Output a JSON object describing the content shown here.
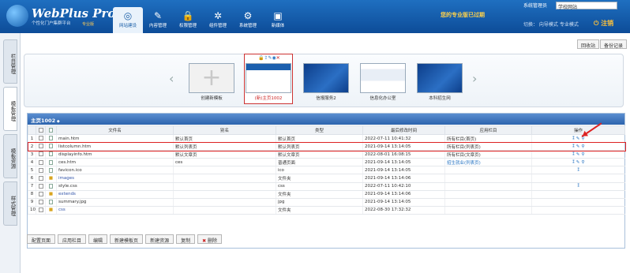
{
  "header": {
    "logo": "WebPlus Pro",
    "subtitle": "个性化门户集群平台",
    "edition": "专业版",
    "slogan": "您的专业版已过期",
    "user_label": "系统管理员",
    "site_select_value": "学校网站",
    "mode_links": "切换：  向导模式  专业模式",
    "logout_label": "注销",
    "nav": [
      "网站建设",
      "内容管理",
      "权限管理",
      "组件管理",
      "系统管理",
      "新媒体"
    ]
  },
  "sidebar": {
    "tabs": [
      "栏目管理",
      "模板管理",
      "模板资源",
      "样式管理"
    ]
  },
  "toolbar": {
    "recycle_label": "回收站",
    "backup_label": "备份记录"
  },
  "templates": {
    "items": [
      {
        "caption": "创建新模板",
        "thumb": "plus"
      },
      {
        "caption": "(新)主页1002",
        "thumb": "news"
      },
      {
        "caption": "信报服务2",
        "thumb": "blue"
      },
      {
        "caption": "信息化办公室",
        "thumb": "site"
      },
      {
        "caption": "本科招生网",
        "thumb": "blue"
      }
    ],
    "selected_icons": [
      "lock-icon",
      "export-icon",
      "edit-icon",
      "preview-icon",
      "close-icon"
    ]
  },
  "panel": {
    "title": "主页1002",
    "columns": [
      "",
      "",
      "",
      "文件名",
      "别名",
      "类型",
      "最后修改时间",
      "应用栏目",
      "操作"
    ],
    "rows": [
      {
        "no": "1",
        "name": "main.htm",
        "alias": "默认首页",
        "type": "默认首页",
        "time": "2022-07-11 10:41:32",
        "column": "所有栏目(首页)",
        "folder": false
      },
      {
        "no": "2",
        "name": "listcolumn.htm",
        "alias": "默认列表页",
        "type": "默认列表页",
        "time": "2021-09-14 13:14:05",
        "column": "所有栏目(列表页)",
        "folder": false
      },
      {
        "no": "3",
        "name": "displayinfo.htm",
        "alias": "默认文章页",
        "type": "默认文章页",
        "time": "2022-08-01 16:08:15",
        "column": "所有栏目(文章页)",
        "folder": false
      },
      {
        "no": "4",
        "name": "ces.htm",
        "alias": "ces",
        "type": "普通页面",
        "time": "2021-09-14 13:14:05",
        "column": "招生就业(列表页)",
        "folder": false
      },
      {
        "no": "5",
        "name": "favicon.ico",
        "alias": "",
        "type": "ico",
        "time": "2021-09-14 13:14:05",
        "column": "",
        "folder": false
      },
      {
        "no": "6",
        "name": "images",
        "alias": "",
        "type": "文件夹",
        "time": "2021-09-14 13:14:06",
        "column": "",
        "folder": true
      },
      {
        "no": "7",
        "name": "style.css",
        "alias": "",
        "type": "css",
        "time": "2022-07-11 10:42:10",
        "column": "",
        "folder": false
      },
      {
        "no": "8",
        "name": "extends",
        "alias": "",
        "type": "文件夹",
        "time": "2021-09-14 13:14:06",
        "column": "",
        "folder": true
      },
      {
        "no": "9",
        "name": "summary.jpg",
        "alias": "",
        "type": "jpg",
        "time": "2021-09-14 13:14:05",
        "column": "",
        "folder": false
      },
      {
        "no": "10",
        "name": "css",
        "alias": "",
        "type": "文件夹",
        "time": "2022-08-30 17:32:32",
        "column": "",
        "folder": true
      }
    ]
  },
  "bottom_buttons": [
    "配置页面",
    "应用栏目",
    "编辑",
    "新建模板页",
    "新建资源",
    "复制",
    "删除"
  ]
}
